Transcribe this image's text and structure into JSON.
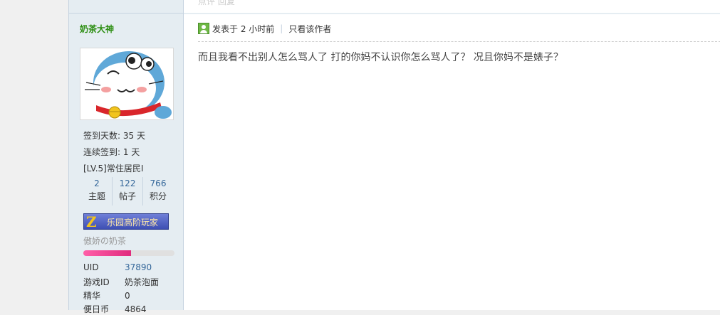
{
  "post": {
    "top_actions": "点评   回复",
    "posted_label": "发表于 2 小时前",
    "separator": "|",
    "only_author_label": "只看该作者",
    "body": "而且我看不出别人怎么骂人了 打的你妈不认识你怎么骂人了？  况且你妈不是婊子？"
  },
  "author": {
    "name": "奶茶大神",
    "avatar_icon": "doraemon-avatar",
    "sign_days": "签到天数: 35 天",
    "streak_days": "连续签到: 1 天",
    "level": "[LV.5]常住居民I",
    "counts": [
      {
        "num": "2",
        "label": "主题"
      },
      {
        "num": "122",
        "label": "帖子"
      },
      {
        "num": "766",
        "label": "积分"
      }
    ],
    "badge_letter": "Z",
    "badge_label": "乐园高阶玩家",
    "group": "傲娇の奶茶",
    "progress": 0.52,
    "details": [
      {
        "label": "UID",
        "value": "37890"
      },
      {
        "label": "游戏ID",
        "value": "奶茶泡面"
      },
      {
        "label": "精华",
        "value": "0"
      },
      {
        "label": "便日币",
        "value": "4864"
      }
    ]
  },
  "colors": {
    "author_green": "#2a8d0f",
    "link_blue": "#336699",
    "sidebar_bg": "#e5edf2",
    "progress_pink": "#e02b7e"
  }
}
